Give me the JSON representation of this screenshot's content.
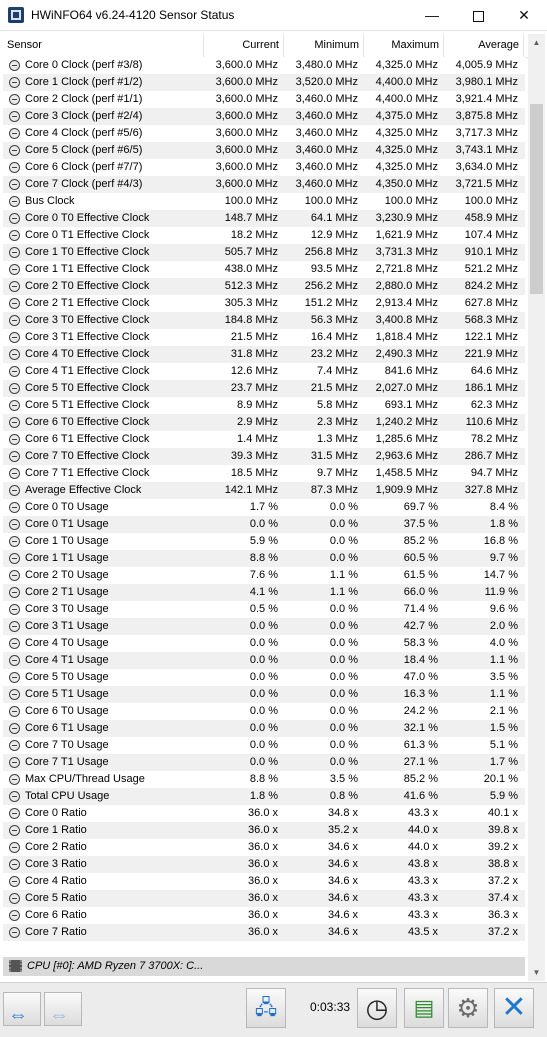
{
  "window": {
    "title": "HWiNFO64 v6.24-4120 Sensor Status",
    "minimize": "—",
    "close": "✕"
  },
  "columns": {
    "sensor": "Sensor",
    "current": "Current",
    "minimum": "Minimum",
    "maximum": "Maximum",
    "average": "Average"
  },
  "rows": [
    {
      "name": "Core 0 Clock (perf #3/8)",
      "current": "3,600.0 MHz",
      "min": "3,480.0 MHz",
      "max": "4,325.0 MHz",
      "avg": "4,005.9 MHz"
    },
    {
      "name": "Core 1 Clock (perf #1/2)",
      "current": "3,600.0 MHz",
      "min": "3,520.0 MHz",
      "max": "4,400.0 MHz",
      "avg": "3,980.1 MHz"
    },
    {
      "name": "Core 2 Clock (perf #1/1)",
      "current": "3,600.0 MHz",
      "min": "3,460.0 MHz",
      "max": "4,400.0 MHz",
      "avg": "3,921.4 MHz"
    },
    {
      "name": "Core 3 Clock (perf #2/4)",
      "current": "3,600.0 MHz",
      "min": "3,460.0 MHz",
      "max": "4,375.0 MHz",
      "avg": "3,875.8 MHz"
    },
    {
      "name": "Core 4 Clock (perf #5/6)",
      "current": "3,600.0 MHz",
      "min": "3,460.0 MHz",
      "max": "4,325.0 MHz",
      "avg": "3,717.3 MHz"
    },
    {
      "name": "Core 5 Clock (perf #6/5)",
      "current": "3,600.0 MHz",
      "min": "3,460.0 MHz",
      "max": "4,325.0 MHz",
      "avg": "3,743.1 MHz"
    },
    {
      "name": "Core 6 Clock (perf #7/7)",
      "current": "3,600.0 MHz",
      "min": "3,460.0 MHz",
      "max": "4,325.0 MHz",
      "avg": "3,634.0 MHz"
    },
    {
      "name": "Core 7 Clock (perf #4/3)",
      "current": "3,600.0 MHz",
      "min": "3,460.0 MHz",
      "max": "4,350.0 MHz",
      "avg": "3,721.5 MHz"
    },
    {
      "name": "Bus Clock",
      "current": "100.0 MHz",
      "min": "100.0 MHz",
      "max": "100.0 MHz",
      "avg": "100.0 MHz"
    },
    {
      "name": "Core 0 T0 Effective Clock",
      "current": "148.7 MHz",
      "min": "64.1 MHz",
      "max": "3,230.9 MHz",
      "avg": "458.9 MHz"
    },
    {
      "name": "Core 0 T1 Effective Clock",
      "current": "18.2 MHz",
      "min": "12.9 MHz",
      "max": "1,621.9 MHz",
      "avg": "107.4 MHz"
    },
    {
      "name": "Core 1 T0 Effective Clock",
      "current": "505.7 MHz",
      "min": "256.8 MHz",
      "max": "3,731.3 MHz",
      "avg": "910.1 MHz"
    },
    {
      "name": "Core 1 T1 Effective Clock",
      "current": "438.0 MHz",
      "min": "93.5 MHz",
      "max": "2,721.8 MHz",
      "avg": "521.2 MHz"
    },
    {
      "name": "Core 2 T0 Effective Clock",
      "current": "512.3 MHz",
      "min": "256.2 MHz",
      "max": "2,880.0 MHz",
      "avg": "824.2 MHz"
    },
    {
      "name": "Core 2 T1 Effective Clock",
      "current": "305.3 MHz",
      "min": "151.2 MHz",
      "max": "2,913.4 MHz",
      "avg": "627.8 MHz"
    },
    {
      "name": "Core 3 T0 Effective Clock",
      "current": "184.8 MHz",
      "min": "56.3 MHz",
      "max": "3,400.8 MHz",
      "avg": "568.3 MHz"
    },
    {
      "name": "Core 3 T1 Effective Clock",
      "current": "21.5 MHz",
      "min": "16.4 MHz",
      "max": "1,818.4 MHz",
      "avg": "122.1 MHz"
    },
    {
      "name": "Core 4 T0 Effective Clock",
      "current": "31.8 MHz",
      "min": "23.2 MHz",
      "max": "2,490.3 MHz",
      "avg": "221.9 MHz"
    },
    {
      "name": "Core 4 T1 Effective Clock",
      "current": "12.6 MHz",
      "min": "7.4 MHz",
      "max": "841.6 MHz",
      "avg": "64.6 MHz"
    },
    {
      "name": "Core 5 T0 Effective Clock",
      "current": "23.7 MHz",
      "min": "21.5 MHz",
      "max": "2,027.0 MHz",
      "avg": "186.1 MHz"
    },
    {
      "name": "Core 5 T1 Effective Clock",
      "current": "8.9 MHz",
      "min": "5.8 MHz",
      "max": "693.1 MHz",
      "avg": "62.3 MHz"
    },
    {
      "name": "Core 6 T0 Effective Clock",
      "current": "2.9 MHz",
      "min": "2.3 MHz",
      "max": "1,240.2 MHz",
      "avg": "110.6 MHz"
    },
    {
      "name": "Core 6 T1 Effective Clock",
      "current": "1.4 MHz",
      "min": "1.3 MHz",
      "max": "1,285.6 MHz",
      "avg": "78.2 MHz"
    },
    {
      "name": "Core 7 T0 Effective Clock",
      "current": "39.3 MHz",
      "min": "31.5 MHz",
      "max": "2,963.6 MHz",
      "avg": "286.7 MHz"
    },
    {
      "name": "Core 7 T1 Effective Clock",
      "current": "18.5 MHz",
      "min": "9.7 MHz",
      "max": "1,458.5 MHz",
      "avg": "94.7 MHz"
    },
    {
      "name": "Average Effective Clock",
      "current": "142.1 MHz",
      "min": "87.3 MHz",
      "max": "1,909.9 MHz",
      "avg": "327.8 MHz"
    },
    {
      "name": "Core 0 T0 Usage",
      "current": "1.7 %",
      "min": "0.0 %",
      "max": "69.7 %",
      "avg": "8.4 %"
    },
    {
      "name": "Core 0 T1 Usage",
      "current": "0.0 %",
      "min": "0.0 %",
      "max": "37.5 %",
      "avg": "1.8 %"
    },
    {
      "name": "Core 1 T0 Usage",
      "current": "5.9 %",
      "min": "0.0 %",
      "max": "85.2 %",
      "avg": "16.8 %"
    },
    {
      "name": "Core 1 T1 Usage",
      "current": "8.8 %",
      "min": "0.0 %",
      "max": "60.5 %",
      "avg": "9.7 %"
    },
    {
      "name": "Core 2 T0 Usage",
      "current": "7.6 %",
      "min": "1.1 %",
      "max": "61.5 %",
      "avg": "14.7 %"
    },
    {
      "name": "Core 2 T1 Usage",
      "current": "4.1 %",
      "min": "1.1 %",
      "max": "66.0 %",
      "avg": "11.9 %"
    },
    {
      "name": "Core 3 T0 Usage",
      "current": "0.5 %",
      "min": "0.0 %",
      "max": "71.4 %",
      "avg": "9.6 %"
    },
    {
      "name": "Core 3 T1 Usage",
      "current": "0.0 %",
      "min": "0.0 %",
      "max": "42.7 %",
      "avg": "2.0 %"
    },
    {
      "name": "Core 4 T0 Usage",
      "current": "0.0 %",
      "min": "0.0 %",
      "max": "58.3 %",
      "avg": "4.0 %"
    },
    {
      "name": "Core 4 T1 Usage",
      "current": "0.0 %",
      "min": "0.0 %",
      "max": "18.4 %",
      "avg": "1.1 %"
    },
    {
      "name": "Core 5 T0 Usage",
      "current": "0.0 %",
      "min": "0.0 %",
      "max": "47.0 %",
      "avg": "3.5 %"
    },
    {
      "name": "Core 5 T1 Usage",
      "current": "0.0 %",
      "min": "0.0 %",
      "max": "16.3 %",
      "avg": "1.1 %"
    },
    {
      "name": "Core 6 T0 Usage",
      "current": "0.0 %",
      "min": "0.0 %",
      "max": "24.2 %",
      "avg": "2.1 %"
    },
    {
      "name": "Core 6 T1 Usage",
      "current": "0.0 %",
      "min": "0.0 %",
      "max": "32.1 %",
      "avg": "1.5 %"
    },
    {
      "name": "Core 7 T0 Usage",
      "current": "0.0 %",
      "min": "0.0 %",
      "max": "61.3 %",
      "avg": "5.1 %"
    },
    {
      "name": "Core 7 T1 Usage",
      "current": "0.0 %",
      "min": "0.0 %",
      "max": "27.1 %",
      "avg": "1.7 %"
    },
    {
      "name": "Max CPU/Thread Usage",
      "current": "8.8 %",
      "min": "3.5 %",
      "max": "85.2 %",
      "avg": "20.1 %"
    },
    {
      "name": "Total CPU Usage",
      "current": "1.8 %",
      "min": "0.8 %",
      "max": "41.6 %",
      "avg": "5.9 %"
    },
    {
      "name": "Core 0 Ratio",
      "current": "36.0 x",
      "min": "34.8 x",
      "max": "43.3 x",
      "avg": "40.1 x"
    },
    {
      "name": "Core 1 Ratio",
      "current": "36.0 x",
      "min": "35.2 x",
      "max": "44.0 x",
      "avg": "39.8 x"
    },
    {
      "name": "Core 2 Ratio",
      "current": "36.0 x",
      "min": "34.6 x",
      "max": "44.0 x",
      "avg": "39.2 x"
    },
    {
      "name": "Core 3 Ratio",
      "current": "36.0 x",
      "min": "34.6 x",
      "max": "43.8 x",
      "avg": "38.8 x"
    },
    {
      "name": "Core 4 Ratio",
      "current": "36.0 x",
      "min": "34.6 x",
      "max": "43.3 x",
      "avg": "37.2 x"
    },
    {
      "name": "Core 5 Ratio",
      "current": "36.0 x",
      "min": "34.6 x",
      "max": "43.3 x",
      "avg": "37.4 x"
    },
    {
      "name": "Core 6 Ratio",
      "current": "36.0 x",
      "min": "34.6 x",
      "max": "43.3 x",
      "avg": "36.3 x"
    },
    {
      "name": "Core 7 Ratio",
      "current": "36.0 x",
      "min": "34.6 x",
      "max": "43.5 x",
      "avg": "37.2 x"
    }
  ],
  "group": {
    "label": "CPU [#0]: AMD Ryzen 7 3700X: C...",
    "icon": "chip-icon"
  },
  "footer": {
    "timer": "0:03:33",
    "icons": {
      "nav_left": "arrows-left-right-icon",
      "nav_right": "arrows-left-right-disabled-icon",
      "network": "network-icon",
      "clock": "clock-icon",
      "report": "report-add-icon",
      "settings": "gear-icon",
      "close": "close-icon"
    }
  },
  "colors": {
    "accent_blue": "#1e78d2",
    "row_alt": "#f0f0f0",
    "group_bg": "#d9d9d9"
  }
}
